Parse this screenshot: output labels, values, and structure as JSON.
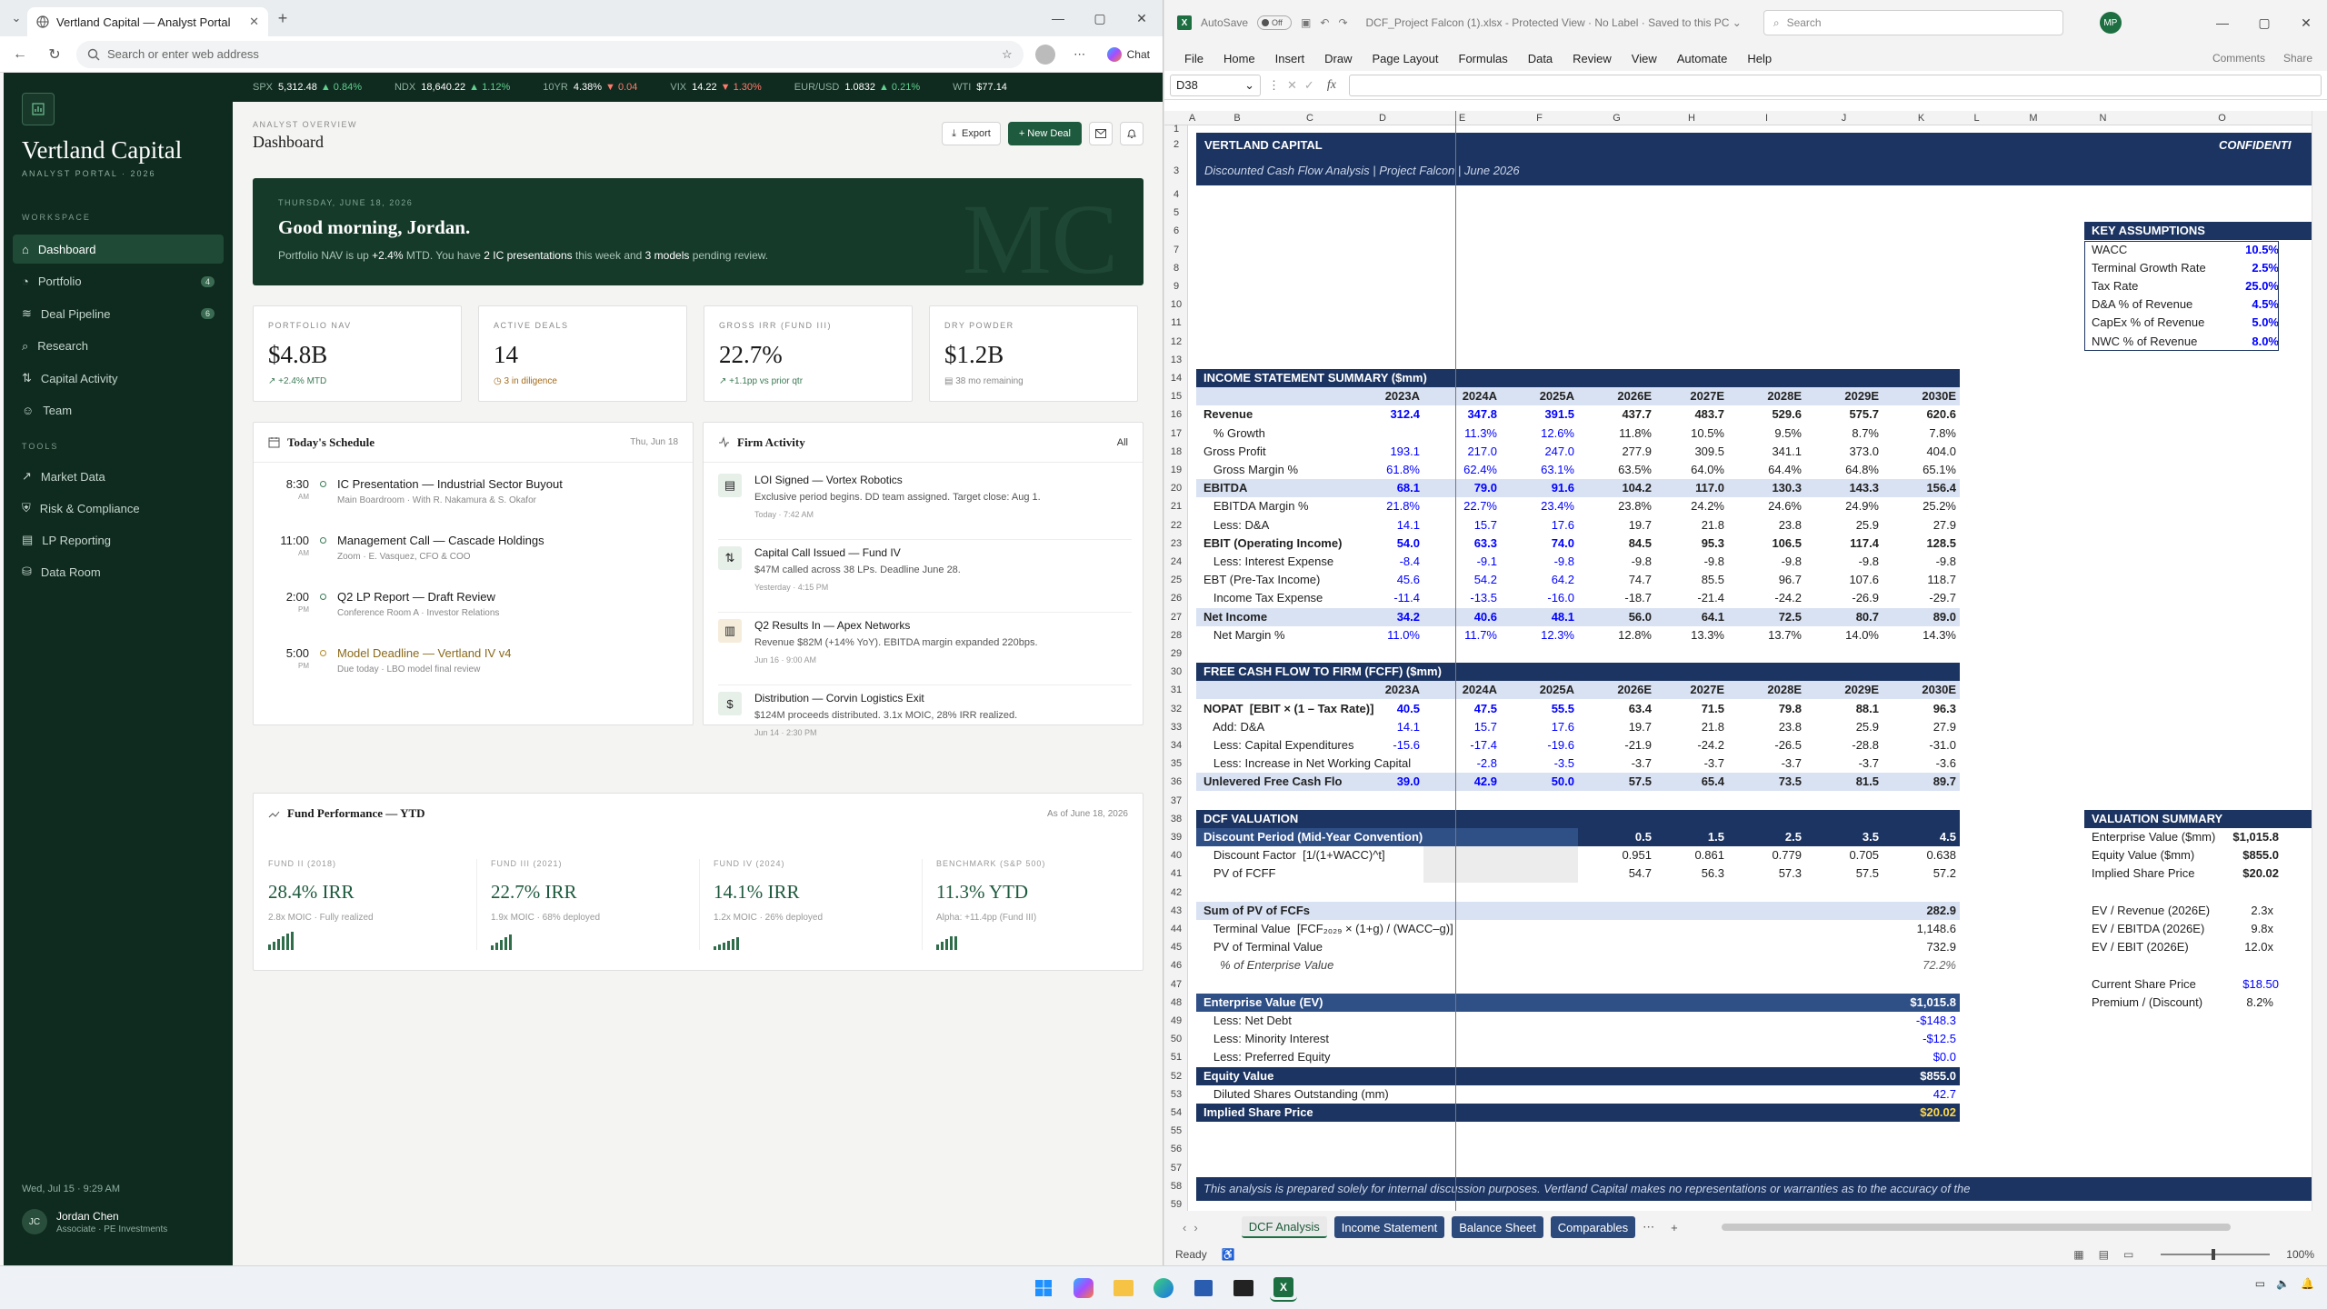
{
  "browser": {
    "tab_title": "Vertland Capital — Analyst Portal",
    "address_placeholder": "Search or enter web address",
    "chat_label": "Chat"
  },
  "sidebar": {
    "brand": "Vertland Capital",
    "brand_sub": "ANALYST PORTAL · 2026",
    "section_workspace": "WORKSPACE",
    "section_tools": "TOOLS",
    "workspace_items": [
      {
        "label": "Dashboard",
        "icon": "home-icon",
        "badge": ""
      },
      {
        "label": "Portfolio",
        "icon": "pie-chart-icon",
        "badge": "4"
      },
      {
        "label": "Deal Pipeline",
        "icon": "layers-icon",
        "badge": "6"
      },
      {
        "label": "Research",
        "icon": "search-icon",
        "badge": ""
      },
      {
        "label": "Capital Activity",
        "icon": "arrows-icon",
        "badge": ""
      },
      {
        "label": "Team",
        "icon": "people-icon",
        "badge": ""
      }
    ],
    "tool_items": [
      {
        "label": "Market Data",
        "icon": "trend-icon"
      },
      {
        "label": "Risk & Compliance",
        "icon": "shield-icon"
      },
      {
        "label": "LP Reporting",
        "icon": "document-icon"
      },
      {
        "label": "Data Room",
        "icon": "database-icon"
      }
    ],
    "datetime": "Wed, Jul 15 · 9:29 AM",
    "user_initials": "JC",
    "user_name": "Jordan Chen",
    "user_role": "Associate · PE Investments"
  },
  "ticker": [
    {
      "sym": "SPX",
      "val": "5,312.48",
      "chg": "▲ 0.84%",
      "dir": "up"
    },
    {
      "sym": "NDX",
      "val": "18,640.22",
      "chg": "▲ 1.12%",
      "dir": "up"
    },
    {
      "sym": "10YR",
      "val": "4.38%",
      "chg": "▼ 0.04",
      "dir": "dn"
    },
    {
      "sym": "VIX",
      "val": "14.22",
      "chg": "▼ 1.30%",
      "dir": "dn"
    },
    {
      "sym": "EUR/USD",
      "val": "1.0832",
      "chg": "▲ 0.21%",
      "dir": "up"
    },
    {
      "sym": "WTI",
      "val": "$77.14",
      "chg": "",
      "dir": "up"
    }
  ],
  "header": {
    "overline": "ANALYST OVERVIEW",
    "title": "Dashboard",
    "export": "Export",
    "new_deal": "+ New Deal"
  },
  "hero": {
    "date": "THURSDAY, JUNE 18, 2026",
    "greeting": "Good morning, Jordan.",
    "t1": "Portfolio NAV is up ",
    "t2": "+2.4%",
    "t3": " MTD. You have ",
    "t4": "2 IC presentations",
    "t5": " this week and ",
    "t6": "3 models",
    "t7": " pending review.",
    "monogram": "MC"
  },
  "kpis": [
    {
      "label": "PORTFOLIO NAV",
      "value": "$4.8B",
      "sub": "↗ +2.4% MTD"
    },
    {
      "label": "ACTIVE DEALS",
      "value": "14",
      "sub": "◷ 3 in diligence"
    },
    {
      "label": "GROSS IRR (FUND III)",
      "value": "22.7%",
      "sub": "↗ +1.1pp vs prior qtr"
    },
    {
      "label": "DRY POWDER",
      "value": "$1.2B",
      "sub": "▤ 38 mo remaining"
    }
  ],
  "schedule": {
    "title": "Today's Schedule",
    "date": "Thu, Jun 18",
    "items": [
      {
        "time": "8:30",
        "ap": "AM",
        "title": "IC Presentation — Industrial Sector Buyout",
        "sub": "Main Boardroom · With R. Nakamura & S. Okafor"
      },
      {
        "time": "11:00",
        "ap": "AM",
        "title": "Management Call — Cascade Holdings",
        "sub": "Zoom · E. Vasquez, CFO & COO"
      },
      {
        "time": "2:00",
        "ap": "PM",
        "title": "Q2 LP Report — Draft Review",
        "sub": "Conference Room A · Investor Relations"
      },
      {
        "time": "5:00",
        "ap": "PM",
        "title": "Model Deadline — Vertland IV v4",
        "sub": "Due today · LBO model final review"
      }
    ]
  },
  "activity": {
    "title": "Firm Activity",
    "filter": "All",
    "items": [
      {
        "title": "LOI Signed — Vortex Robotics",
        "desc": "Exclusive period begins. DD team assigned. Target close: Aug 1.",
        "time": "Today · 7:42 AM"
      },
      {
        "title": "Capital Call Issued — Fund IV",
        "desc": "$47M called across 38 LPs. Deadline June 28.",
        "time": "Yesterday · 4:15 PM"
      },
      {
        "title": "Q2 Results In — Apex Networks",
        "desc": "Revenue $82M (+14% YoY). EBITDA margin expanded 220bps.",
        "time": "Jun 16 · 9:00 AM"
      },
      {
        "title": "Distribution — Corvin Logistics Exit",
        "desc": "$124M proceeds distributed. 3.1x MOIC, 28% IRR realized.",
        "time": "Jun 14 · 2:30 PM"
      }
    ]
  },
  "fund_perf": {
    "title": "Fund Performance — YTD",
    "asof": "As of June 18, 2026",
    "funds": [
      {
        "label": "FUND II (2018)",
        "value": "28.4% IRR",
        "sub": "2.8x MOIC · Fully realized"
      },
      {
        "label": "FUND III (2021)",
        "value": "22.7% IRR",
        "sub": "1.9x MOIC · 68% deployed"
      },
      {
        "label": "FUND IV (2024)",
        "value": "14.1% IRR",
        "sub": "1.2x MOIC · 26% deployed"
      },
      {
        "label": "BENCHMARK (S&P 500)",
        "value": "11.3% YTD",
        "sub": "Alpha: +11.4pp (Fund III)"
      }
    ]
  },
  "excel": {
    "autosave": "AutoSave",
    "autosave_state": "Off",
    "filename": "DCF_Project Falcon (1).xlsx  -  Protected View  ·  No Label  ·  Saved to this PC ⌄",
    "search": "Search",
    "avatar": "MP",
    "menu": [
      "File",
      "Home",
      "Insert",
      "Draw",
      "Page Layout",
      "Formulas",
      "Data",
      "Review",
      "View",
      "Automate",
      "Help"
    ],
    "comments": "Comments",
    "share": "Share",
    "namebox": "D38",
    "sheets": [
      "DCF Analysis",
      "Income Statement",
      "Balance Sheet",
      "Comparables"
    ],
    "status": "Ready",
    "zoom": "100%",
    "title1": "VERTLAND CAPITAL",
    "confidential": "CONFIDENTI",
    "title2": "Discounted Cash Flow Analysis   |   Project Falcon   |   June 2026",
    "years": [
      "2023A",
      "2024A",
      "2025A",
      "2026E",
      "2027E",
      "2028E",
      "2029E",
      "2030E"
    ],
    "is_header": "INCOME STATEMENT SUMMARY  ($mm)",
    "fcf_header": "FREE CASH FLOW TO FIRM (FCFF)  ($mm)",
    "dcf_header": "DCF VALUATION",
    "assumptions_header": "KEY ASSUMPTIONS",
    "valuation_header": "VALUATION SUMMARY",
    "footer_note": "This analysis is prepared solely for internal discussion purposes. Vertland Capital makes no representations or warranties as to the accuracy of the"
  },
  "taskbar": {
    "time": "",
    "apps": [
      "windows-icon",
      "copilot-icon",
      "file-explorer-icon",
      "edge-icon",
      "store-icon",
      "terminal-icon",
      "excel-icon"
    ]
  }
}
